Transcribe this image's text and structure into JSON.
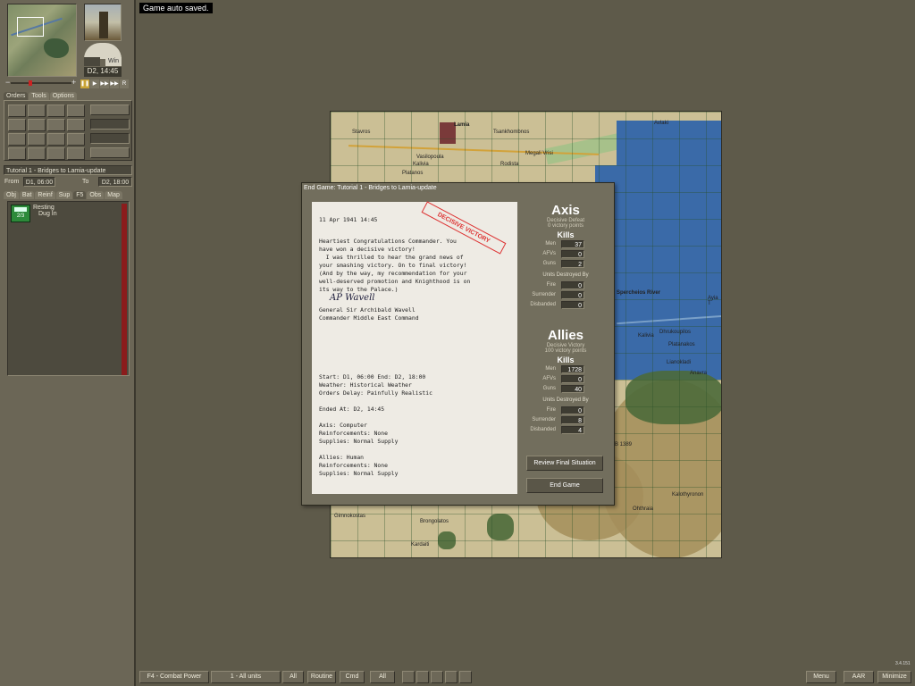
{
  "notice": "Game auto saved.",
  "sidebar": {
    "time": "D2, 14:45",
    "win_label": "Win",
    "tabs": [
      "Orders",
      "Tools",
      "Options"
    ],
    "scenario_title": "Tutorial 1 - Bridges to Lamia-update",
    "from_label": "From",
    "from_value": "D1, 06:00",
    "to_label": "To",
    "to_value": "D2, 18:00",
    "unit_tabs": [
      "Obj",
      "Bat",
      "Reinf",
      "Sup",
      "F5",
      "Obs",
      "Map"
    ],
    "unit": {
      "strength": "2/3",
      "status1": "Resting",
      "status2": "Dug In"
    }
  },
  "map": {
    "labels": [
      "Lamia",
      "Stavros",
      "Tsankhombnos",
      "Megali Vrisi",
      "Avlaki",
      "Vasilopoula",
      "Kalivia",
      "Platanos",
      "Kolovia",
      "Rodista",
      "Kalivia",
      "Dhrukoupilos",
      "Platanakos",
      "Lianokladi",
      "Anavra",
      "Kalothyronon",
      "Ohthraia",
      "Gimnokostas",
      "Brongolatos",
      "Kardaiti",
      "Spercheios River",
      "Ayia T",
      "B 1389"
    ]
  },
  "dialog": {
    "title": "End Game: Tutorial 1 - Bridges to Lamia-update",
    "letter": {
      "date": "11 Apr 1941 14:45",
      "stamp": "DECISIVE VICTORY",
      "body": "Heartiest Congratulations Commander. You\nhave won a decisive victory!\n  I was thrilled to hear the grand news of\nyour smashing victory. On to final victory!\n(And by the way, my recommendation for your\nwell-deserved promotion and Knighthood is on\nits way to the Palace.)",
      "signature": "AP Wavell",
      "signoff": "General Sir Archibald Wavell\nCommander Middle East Command",
      "settings": "Start: D1, 06:00 End: D2, 18:00\nWeather: Historical Weather\nOrders Delay: Painfully Realistic",
      "ended": "Ended At: D2, 14:45",
      "axis_info": "Axis: Computer\nReinforcements: None\nSupplies: Normal Supply",
      "allies_info": "Allies: Human\nReinforcements: None\nSupplies: Normal Supply"
    },
    "axis": {
      "name": "Axis",
      "result": "Decisive Defeat",
      "vp": "0 victory points",
      "kills_label": "Kills",
      "men_label": "Men",
      "men": "37",
      "afv_label": "AFVs",
      "afv": "0",
      "guns_label": "Guns",
      "guns": "2",
      "dest_label": "Units Destroyed By",
      "fire_label": "Fire",
      "fire": "0",
      "surr_label": "Surrender",
      "surr": "0",
      "disb_label": "Disbanded",
      "disb": "0"
    },
    "allies": {
      "name": "Allies",
      "result": "Decisive Victory",
      "vp": "100 victory points",
      "kills_label": "Kills",
      "men_label": "Men",
      "men": "1728",
      "afv_label": "AFVs",
      "afv": "0",
      "guns_label": "Guns",
      "guns": "40",
      "dest_label": "Units Destroyed By",
      "fire_label": "Fire",
      "fire": "0",
      "surr_label": "Surrender",
      "surr": "8",
      "disb_label": "Disbanded",
      "disb": "4"
    },
    "review_button": "Review Final Situation",
    "end_button": "End Game"
  },
  "bottom": {
    "combat_power": "F4 - Combat Power",
    "units": "1 - All units",
    "all1": "All",
    "routine": "Routine",
    "cmd": "Cmd",
    "all2": "All",
    "menu": "Menu",
    "aar": "AAR",
    "minimize": "Minimize",
    "version": "3.4.151"
  }
}
